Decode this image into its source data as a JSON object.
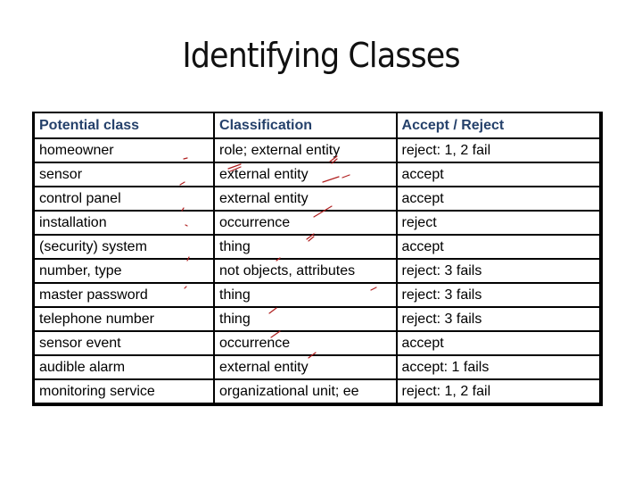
{
  "title": "Identifying Classes",
  "table": {
    "headers": [
      "Potential class",
      "Classification",
      "Accept / Reject"
    ],
    "rows": [
      [
        "homeowner",
        "role; external entity",
        "reject: 1, 2 fail"
      ],
      [
        "sensor",
        "external entity",
        "accept"
      ],
      [
        "control panel",
        "external entity",
        "accept"
      ],
      [
        "installation",
        "occurrence",
        "reject"
      ],
      [
        "(security) system",
        "thing",
        "accept"
      ],
      [
        "number, type",
        "not objects, attributes",
        "reject: 3 fails"
      ],
      [
        "master password",
        "thing",
        "reject: 3 fails"
      ],
      [
        "telephone number",
        "thing",
        "reject: 3 fails"
      ],
      [
        "sensor event",
        "occurrence",
        "accept"
      ],
      [
        "audible alarm",
        "external entity",
        "accept: 1 fails"
      ],
      [
        "monitoring service",
        "organizational unit; ee",
        "reject: 1, 2 fail"
      ]
    ]
  },
  "colors": {
    "header_text": "#25416b",
    "ink_marks": "#b02020"
  }
}
